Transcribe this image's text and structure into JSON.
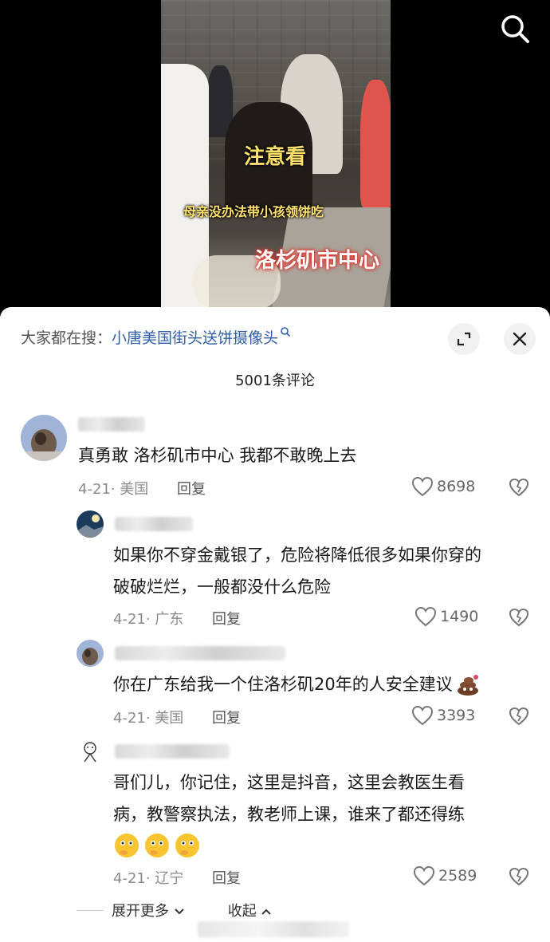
{
  "video": {
    "caption_top": "注意看",
    "caption_middle": "母亲没办法带小孩领饼吃",
    "caption_bottom": "洛杉矶市中心"
  },
  "icons": {
    "search": "search-icon",
    "expand": "expand-icon",
    "close": "close-icon",
    "heart": "heart-icon",
    "broken_heart": "broken-heart-icon",
    "chevron_down": "chevron-down-icon",
    "chevron_up": "chevron-up-icon"
  },
  "search_suggestion": {
    "prefix": "大家都在搜：",
    "query": "小唐美国街头送饼摄像头"
  },
  "comment_count": "5001条评论",
  "comments": [
    {
      "text": "真勇敢 洛杉矶市中心 我都不敢晚上去",
      "date_location": "4-21· 美国",
      "reply_label": "回复",
      "likes": "8698"
    },
    {
      "text_line1": "如果你不穿金戴银了，危险将降低很多如果你穿的",
      "text_line2": "破破烂烂，一般都没什么危险",
      "date_location": "4-21· 广东",
      "reply_label": "回复",
      "likes": "1490"
    },
    {
      "text": "你在广东给我一个住洛杉矶20年的人安全建议",
      "date_location": "4-21· 美国",
      "reply_label": "回复",
      "likes": "3393"
    },
    {
      "text_line1": "哥们儿，你记住，这里是抖音，这里会教医生看",
      "text_line2": "病，教警察执法，教老师上课，谁来了都还得练",
      "date_location": "4-21· 辽宁",
      "reply_label": "回复",
      "likes": "2589"
    }
  ],
  "footer": {
    "expand_more": "展开更多",
    "collapse": "收起"
  }
}
